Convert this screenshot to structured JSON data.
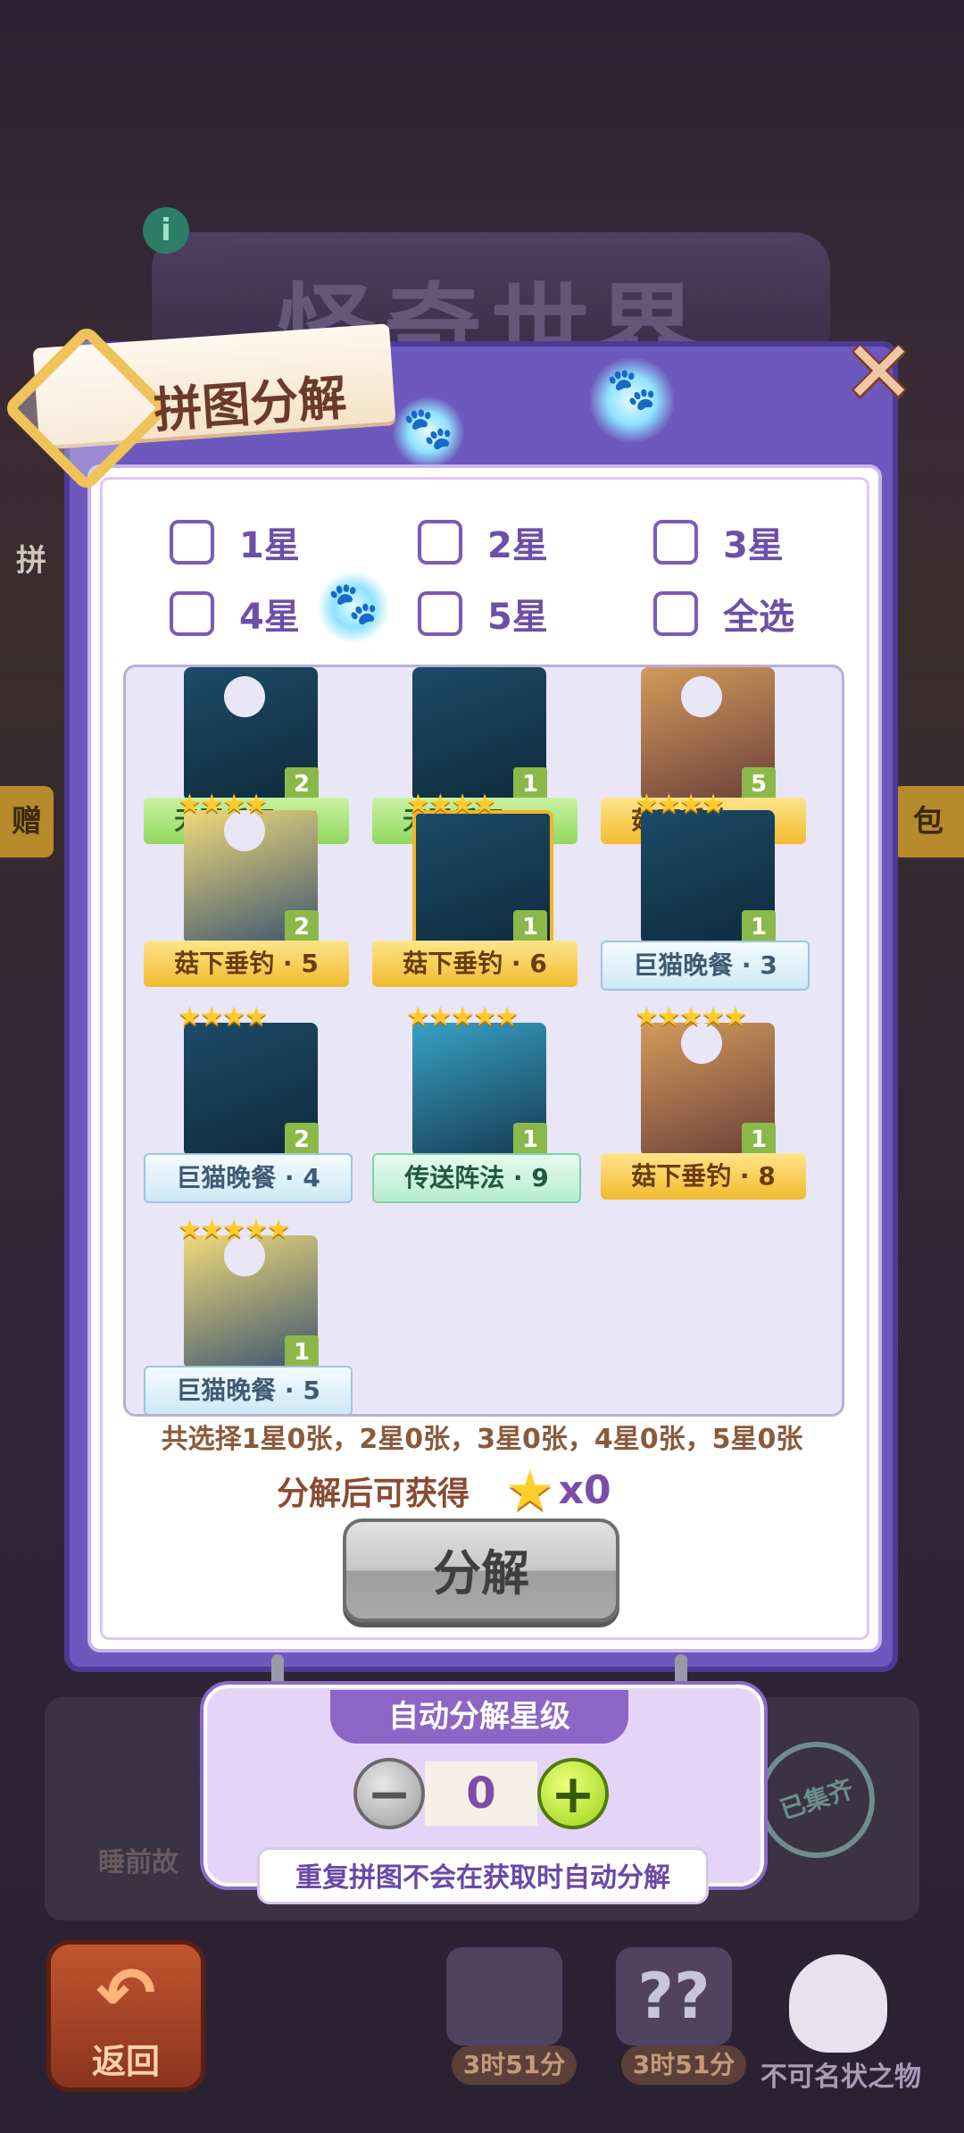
{
  "background": {
    "title": "怪奇世界",
    "left_label": "拼",
    "left_tab": "赠",
    "right_tab": "包",
    "panel_label": "睡前故",
    "stamp": "已集齐"
  },
  "modal": {
    "title": "拼图分解",
    "close_label": "✕"
  },
  "filters": [
    {
      "label": "1星",
      "checked": false
    },
    {
      "label": "2星",
      "checked": false
    },
    {
      "label": "3星",
      "checked": false
    },
    {
      "label": "4星",
      "checked": false
    },
    {
      "label": "5星",
      "checked": false
    },
    {
      "label": "全选",
      "checked": false
    }
  ],
  "cards": [
    {
      "name": "无限循环 · 6",
      "count": "2",
      "stars": "",
      "ribbon": "green",
      "art": "night"
    },
    {
      "name": "无限循环 · 7",
      "count": "1",
      "stars": "",
      "ribbon": "green",
      "art": "night"
    },
    {
      "name": "菇下垂钓 · 4",
      "count": "5",
      "stars": "",
      "ribbon": "gold",
      "art": "warm"
    },
    {
      "name": "菇下垂钓 · 5",
      "count": "2",
      "stars": "★★★★",
      "ribbon": "gold",
      "art": "gold"
    },
    {
      "name": "菇下垂钓 · 6",
      "count": "1",
      "stars": "★★★★",
      "ribbon": "gold",
      "art": "night"
    },
    {
      "name": "巨猫晚餐 · 3",
      "count": "1",
      "stars": "★★★★",
      "ribbon": "blue",
      "art": "night"
    },
    {
      "name": "巨猫晚餐 · 4",
      "count": "2",
      "stars": "★★★★",
      "ribbon": "blue",
      "art": "night"
    },
    {
      "name": "传送阵法 · 9",
      "count": "1",
      "stars": "★★★★★",
      "ribbon": "mint",
      "art": "teal"
    },
    {
      "name": "菇下垂钓 · 8",
      "count": "1",
      "stars": "★★★★★",
      "ribbon": "gold",
      "art": "warm"
    },
    {
      "name": "巨猫晚餐 · 5",
      "count": "1",
      "stars": "★★★★★",
      "ribbon": "blue",
      "art": "gold"
    }
  ],
  "summary": "共选择1星0张，2星0张，3星0张，4星0张，5星0张",
  "gain": {
    "label": "分解后可获得",
    "star_icon": "★",
    "amount": "x0"
  },
  "decompose_button": "分解",
  "auto": {
    "title": "自动分解星级",
    "level": "0",
    "minus": "−",
    "plus": "+",
    "tip": "重复拼图不会在获取时自动分解"
  },
  "bottom": {
    "back_label": "返回",
    "timer1": "3时51分",
    "timer2": "3时51分",
    "ghost_label": "不可名状之物"
  },
  "colors": {
    "modal_bg": "#6d58bd",
    "checkbox_border": "#7a5bb5",
    "count_badge": "#8ab94a",
    "star": "#ffcb2b"
  }
}
